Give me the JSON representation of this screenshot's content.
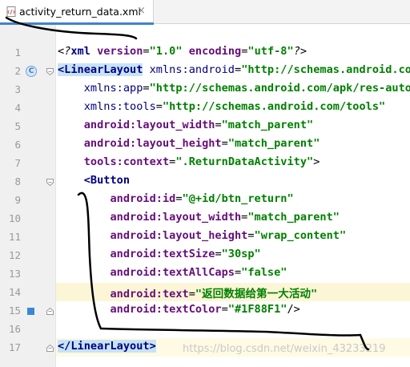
{
  "tab": {
    "filename": "activity_return_data.xml",
    "close_glyph": "×",
    "icon": "xml-file-icon",
    "close_icon": "close-icon"
  },
  "lines": [
    {
      "num": "1",
      "tokens": [
        [
          "pi",
          "<?"
        ],
        [
          "c-tag",
          "xml "
        ],
        [
          "c-attr",
          "version"
        ],
        [
          "c-punc",
          "="
        ],
        [
          "c-val",
          "\"1.0\" "
        ],
        [
          "c-attr",
          "encoding"
        ],
        [
          "c-punc",
          "="
        ],
        [
          "c-val",
          "\"utf-8\""
        ],
        [
          "pi",
          "?>"
        ]
      ]
    },
    {
      "num": "2",
      "tokens": [
        [
          "c-tag tag-hl",
          "<LinearLayout"
        ],
        [
          "c-punc",
          " "
        ],
        [
          "c-nsplain",
          "xmlns:android"
        ],
        [
          "c-punc",
          "="
        ],
        [
          "c-val",
          "\"http://schemas.android.com/apk/res/android\""
        ]
      ]
    },
    {
      "num": "3",
      "tokens": [
        [
          "c-punc",
          "    "
        ],
        [
          "c-nsplain",
          "xmlns:app"
        ],
        [
          "c-punc",
          "="
        ],
        [
          "c-val",
          "\"http://schemas.android.com/apk/res-auto\""
        ]
      ]
    },
    {
      "num": "4",
      "tokens": [
        [
          "c-punc",
          "    "
        ],
        [
          "c-nsplain",
          "xmlns:tools"
        ],
        [
          "c-punc",
          "="
        ],
        [
          "c-val",
          "\"http://schemas.android.com/tools\""
        ]
      ]
    },
    {
      "num": "5",
      "tokens": [
        [
          "c-punc",
          "    "
        ],
        [
          "c-attr",
          "android:layout_width"
        ],
        [
          "c-punc",
          "="
        ],
        [
          "c-val",
          "\"match_parent\""
        ]
      ]
    },
    {
      "num": "6",
      "tokens": [
        [
          "c-punc",
          "    "
        ],
        [
          "c-attr",
          "android:layout_height"
        ],
        [
          "c-punc",
          "="
        ],
        [
          "c-val",
          "\"match_parent\""
        ]
      ]
    },
    {
      "num": "7",
      "tokens": [
        [
          "c-punc",
          "    "
        ],
        [
          "c-attr",
          "tools:context"
        ],
        [
          "c-punc",
          "="
        ],
        [
          "c-val",
          "\".ReturnDataActivity\""
        ],
        [
          "c-punc",
          ">"
        ]
      ]
    },
    {
      "num": "8",
      "tokens": [
        [
          "c-punc",
          "    "
        ],
        [
          "c-tag",
          "<Button"
        ]
      ]
    },
    {
      "num": "9",
      "tokens": [
        [
          "c-punc",
          "        "
        ],
        [
          "c-attr",
          "android:id"
        ],
        [
          "c-punc",
          "="
        ],
        [
          "c-val",
          "\"@+id/btn_return\""
        ]
      ]
    },
    {
      "num": "10",
      "tokens": [
        [
          "c-punc",
          "        "
        ],
        [
          "c-attr",
          "android:layout_width"
        ],
        [
          "c-punc",
          "="
        ],
        [
          "c-val",
          "\"match_parent\""
        ]
      ]
    },
    {
      "num": "11",
      "tokens": [
        [
          "c-punc",
          "        "
        ],
        [
          "c-attr",
          "android:layout_height"
        ],
        [
          "c-punc",
          "="
        ],
        [
          "c-val",
          "\"wrap_content\""
        ]
      ]
    },
    {
      "num": "12",
      "tokens": [
        [
          "c-punc",
          "        "
        ],
        [
          "c-attr",
          "android:textSize"
        ],
        [
          "c-punc",
          "="
        ],
        [
          "c-val",
          "\"30sp\""
        ]
      ]
    },
    {
      "num": "13",
      "tokens": [
        [
          "c-punc",
          "        "
        ],
        [
          "c-attr",
          "android:textAllCaps"
        ],
        [
          "c-punc",
          "="
        ],
        [
          "c-val",
          "\"false\""
        ]
      ]
    },
    {
      "num": "14",
      "tokens": [
        [
          "c-punc",
          "        "
        ],
        [
          "c-attr",
          "android:text"
        ],
        [
          "c-punc",
          "="
        ],
        [
          "c-val",
          "\"返回数据给第一大活动\""
        ]
      ],
      "highlight": true
    },
    {
      "num": "15",
      "tokens": [
        [
          "c-punc",
          "        "
        ],
        [
          "c-attr",
          "android:textColor"
        ],
        [
          "c-punc",
          "="
        ],
        [
          "c-val",
          "\"#1F88F1\""
        ],
        [
          "c-punc",
          "/>"
        ]
      ]
    },
    {
      "num": "16",
      "tokens": []
    },
    {
      "num": "17",
      "tokens": [
        [
          "c-tag tag-hl",
          "</LinearLayout>"
        ]
      ],
      "caret": true
    }
  ],
  "gutter_markers": {
    "line2": "C",
    "line15": "square"
  },
  "watermark": "https://blog.csdn.net/weixin_43233219",
  "colors": {
    "attr": "#660e7a",
    "value": "#008000",
    "tag": "#000080",
    "tab_accent": "#4083c9",
    "highlight_line": "#fcf6d6",
    "tag_match": "#c7e3f6"
  }
}
